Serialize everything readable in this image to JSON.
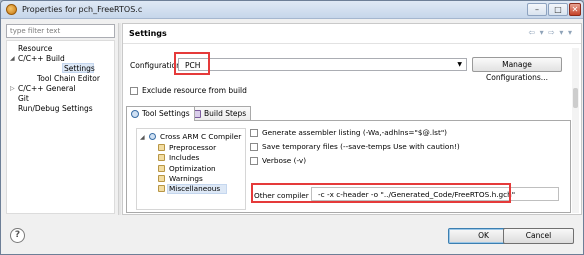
{
  "window": {
    "title": "Properties for pch_FreeRTOS.c"
  },
  "left": {
    "filter_placeholder": "type filter text",
    "tree": [
      {
        "label": "Resource"
      },
      {
        "label": "C/C++ Build"
      },
      {
        "label": "Settings"
      },
      {
        "label": "Tool Chain Editor"
      },
      {
        "label": "C/C++ General"
      },
      {
        "label": "Git"
      },
      {
        "label": "Run/Debug Settings"
      }
    ]
  },
  "settings": {
    "title": "Settings",
    "configuration_label": "Configuration:",
    "configuration_value": "PCH",
    "manage_button": "Manage Configurations...",
    "exclude_label": "Exclude resource from build",
    "tabs": [
      {
        "label": "Tool Settings"
      },
      {
        "label": "Build Steps"
      }
    ],
    "tool_tree": {
      "root": "Cross ARM C Compiler",
      "children": [
        "Preprocessor",
        "Includes",
        "Optimization",
        "Warnings",
        "Miscellaneous"
      ]
    },
    "options": [
      {
        "label": "Generate assembler listing (-Wa,-adhlns=\"$@.lst\")"
      },
      {
        "label": "Save temporary files (--save-temps Use with caution!)"
      },
      {
        "label": "Verbose (-v)"
      }
    ],
    "other_flags_label": "Other compiler flags",
    "other_flags_value": "-c -x c-header -o \"../Generated_Code/FreeRTOS.h.gch\""
  },
  "footer": {
    "help": "?",
    "ok": "OK",
    "cancel": "Cancel"
  },
  "colors": {
    "highlight_box": "#e53a3a",
    "selection": "#dde8f6"
  }
}
